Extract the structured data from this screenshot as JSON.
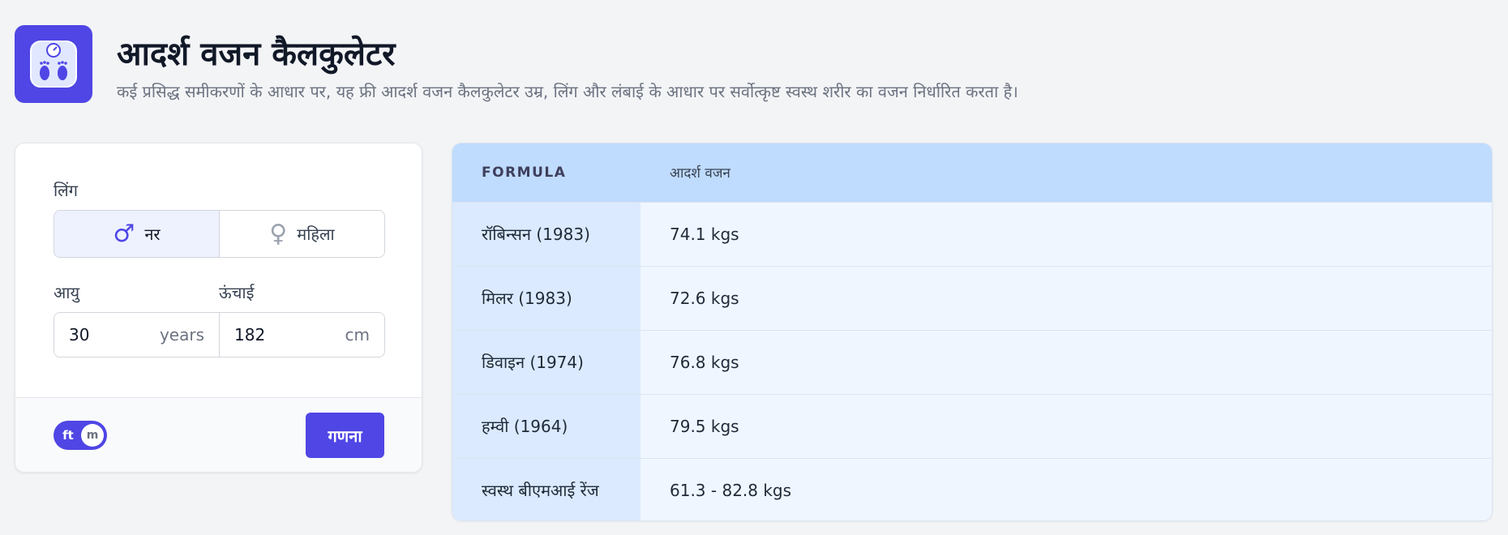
{
  "header": {
    "title": "आदर्श वजन कैलकुलेटर",
    "subtitle": "कई प्रसिद्ध समीकरणों के आधार पर, यह फ्री आदर्श वजन कैलकुलेटर उम्र, लिंग और लंबाई के आधार पर सर्वोत्कृष्ट स्वस्थ शरीर का वजन निर्धारित करता है।",
    "icon": "scale-feet-icon"
  },
  "form": {
    "gender_label": "लिंग",
    "gender_options": [
      {
        "label": "नर",
        "icon": "male-icon",
        "selected": true
      },
      {
        "label": "महिला",
        "icon": "female-icon",
        "selected": false
      }
    ],
    "age_label": "आयु",
    "age_value": "30",
    "age_unit": "years",
    "height_label": "ऊंचाई",
    "height_value": "182",
    "height_unit": "cm",
    "unit_toggle": {
      "left": "ft",
      "right": "m"
    },
    "calculate_label": "गणना"
  },
  "results": {
    "headers": [
      "FORMULA",
      "आदर्श वजन"
    ],
    "rows": [
      {
        "formula": "रॉबिन्सन (1983)",
        "weight": "74.1 kgs"
      },
      {
        "formula": "मिलर (1983)",
        "weight": "72.6 kgs"
      },
      {
        "formula": "डिवाइन (1974)",
        "weight": "76.8 kgs"
      },
      {
        "formula": "हम्वी (1964)",
        "weight": "79.5 kgs"
      },
      {
        "formula": "स्वस्थ बीएमआई रेंज",
        "weight": "61.3 - 82.8 kgs"
      }
    ]
  },
  "colors": {
    "accent": "#4f46e5",
    "table_header": "#bfdbfe",
    "table_first_col": "#dbeafe",
    "table_cell": "#eff6ff",
    "background": "#f3f4f6"
  }
}
